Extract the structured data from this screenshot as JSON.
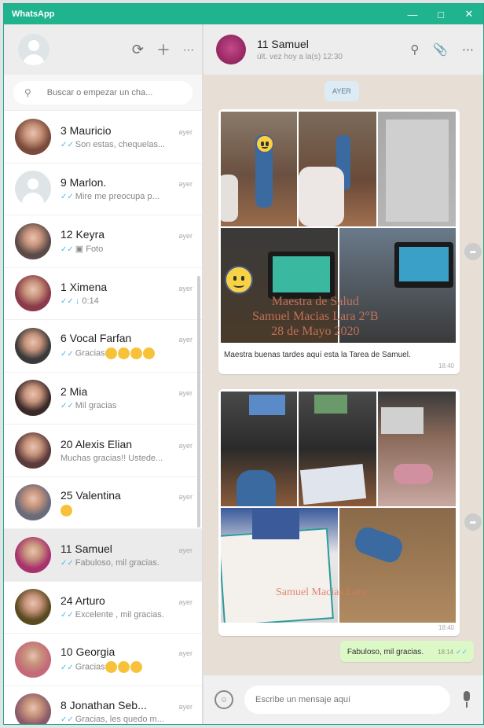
{
  "window": {
    "title": "WhatsApp"
  },
  "sidebar": {
    "search_placeholder": "Buscar o empezar un cha...",
    "chats": [
      {
        "name": "3 Mauricio",
        "time": "ayer",
        "preview": "Son estas, chequelas...",
        "ticks": true,
        "color": "#7a4a3a"
      },
      {
        "name": "9 Marlon.",
        "time": "ayer",
        "preview": "Mire me preocupa p...",
        "ticks": true,
        "blank": true,
        "color": "#dfe5e7"
      },
      {
        "name": "12 Keyra",
        "time": "ayer",
        "preview": "Foto",
        "ticks": true,
        "photo_icon": true,
        "color": "#5a4a48"
      },
      {
        "name": "1 Ximena",
        "time": "ayer",
        "preview": "0:14",
        "ticks": true,
        "mic_icon": true,
        "color": "#8a3a4a"
      },
      {
        "name": "6 Vocal Farfan",
        "time": "ayer",
        "preview": "Gracias",
        "ticks": true,
        "emojis": 4,
        "color": "#3a3a3a"
      },
      {
        "name": "2 Mia",
        "time": "ayer",
        "preview": "Mil gracias",
        "ticks": true,
        "color": "#3a2a2a"
      },
      {
        "name": "20 Alexis Elian",
        "time": "ayer",
        "preview": "Muchas gracias!! Ustede...",
        "ticks": false,
        "color": "#5a3a3a"
      },
      {
        "name": "25 Valentina",
        "time": "ayer",
        "preview": "",
        "ticks": false,
        "emojis": 1,
        "color": "#6a6a7a"
      },
      {
        "name": "11 Samuel",
        "time": "ayer",
        "preview": "Fabuloso, mil gracias.",
        "ticks": true,
        "active": true,
        "color": "#a8326e"
      },
      {
        "name": "24 Arturo",
        "time": "ayer",
        "preview": "Excelente , mil gracias.",
        "ticks": true,
        "color": "#5a4a20"
      },
      {
        "name": "10 Georgia",
        "time": "ayer",
        "preview": "Gracias",
        "ticks": true,
        "emojis": 3,
        "color": "#c46a78"
      },
      {
        "name": "8 Jonathan Seb...",
        "time": "ayer",
        "preview": "Gracias, les quedo m...",
        "ticks": true,
        "color": "#8a5a6a"
      }
    ]
  },
  "conversation": {
    "contact_name": "11 Samuel",
    "contact_status": "últ. vez hoy a la(s) 12:30",
    "day_label": "AYER",
    "message1": {
      "watermark_lines": [
        "Maestra de Salud",
        "Samuel Macias Lara 2°B",
        "28 de Mayo 2020"
      ],
      "caption": "Maestra buenas tardes aquí esta la Tarea de Samuel.",
      "time": "18:40"
    },
    "message2": {
      "time": "18:40",
      "watermark_lines": [
        "Samuel Macias Lara"
      ]
    },
    "outgoing": {
      "text": "Fabuloso, mil gracias.",
      "time": "18:14"
    },
    "composer_placeholder": "Escribe un mensaje aquí"
  },
  "colors": {
    "brand": "#1fb38e",
    "outgoing_bubble": "#dcf8c6",
    "chat_bg": "#e7dfd6"
  }
}
